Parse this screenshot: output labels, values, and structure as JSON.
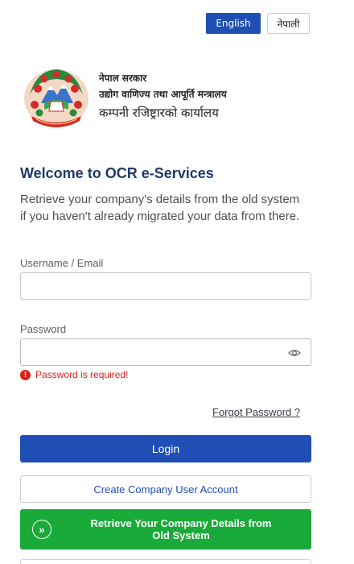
{
  "language": {
    "english_label": "English",
    "nepali_label": "नेपाली",
    "active": "English"
  },
  "brand": {
    "gov_line": "नेपाल सरकार",
    "ministry_line": "उद्योग वाणिज्य तथा आपूर्ति मन्त्रालय",
    "office_line": "कम्पनी रजिष्ट्रारको कार्यालय"
  },
  "form": {
    "title": "Welcome to OCR e-Services",
    "subtitle": "Retrieve your company's details from the old system if you haven't already migrated your data from there.",
    "username_label": "Username / Email",
    "username_value": "",
    "password_label": "Password",
    "password_value": "",
    "password_error": "Password is required!",
    "forgot_label": "Forgot Password ?",
    "login_label": "Login",
    "create_label": "Create Company User Account",
    "retrieve_label_line1": "Retrieve Your Company Details from",
    "retrieve_label_line2": "Old System"
  },
  "colors": {
    "primary": "#1f4fb5",
    "success": "#1aaa3a",
    "error": "#e0201a",
    "title": "#1f3a6b"
  },
  "icons": {
    "emblem": "nepal-emblem-icon",
    "eye": "eye-icon",
    "error": "error-icon",
    "retrieve": "double-chevron-right-icon"
  }
}
